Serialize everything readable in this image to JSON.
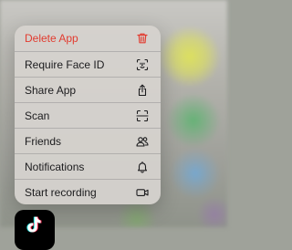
{
  "context_menu": {
    "items": [
      {
        "label": "Delete App",
        "icon": "trash-icon",
        "destructive": true
      },
      {
        "label": "Require Face ID",
        "icon": "face-id-icon",
        "destructive": false
      },
      {
        "label": "Share App",
        "icon": "share-icon",
        "destructive": false
      },
      {
        "label": "Scan",
        "icon": "scan-icon",
        "destructive": false
      },
      {
        "label": "Friends",
        "icon": "friends-icon",
        "destructive": false
      },
      {
        "label": "Notifications",
        "icon": "bell-icon",
        "destructive": false
      },
      {
        "label": "Start recording",
        "icon": "video-camera-icon",
        "destructive": false
      }
    ]
  },
  "app_icon": {
    "icon": "tiktok-logo-icon"
  },
  "colors": {
    "destructive": "#e23c30",
    "text": "#1c1c1e",
    "menu_background": "#d6d2ce"
  }
}
